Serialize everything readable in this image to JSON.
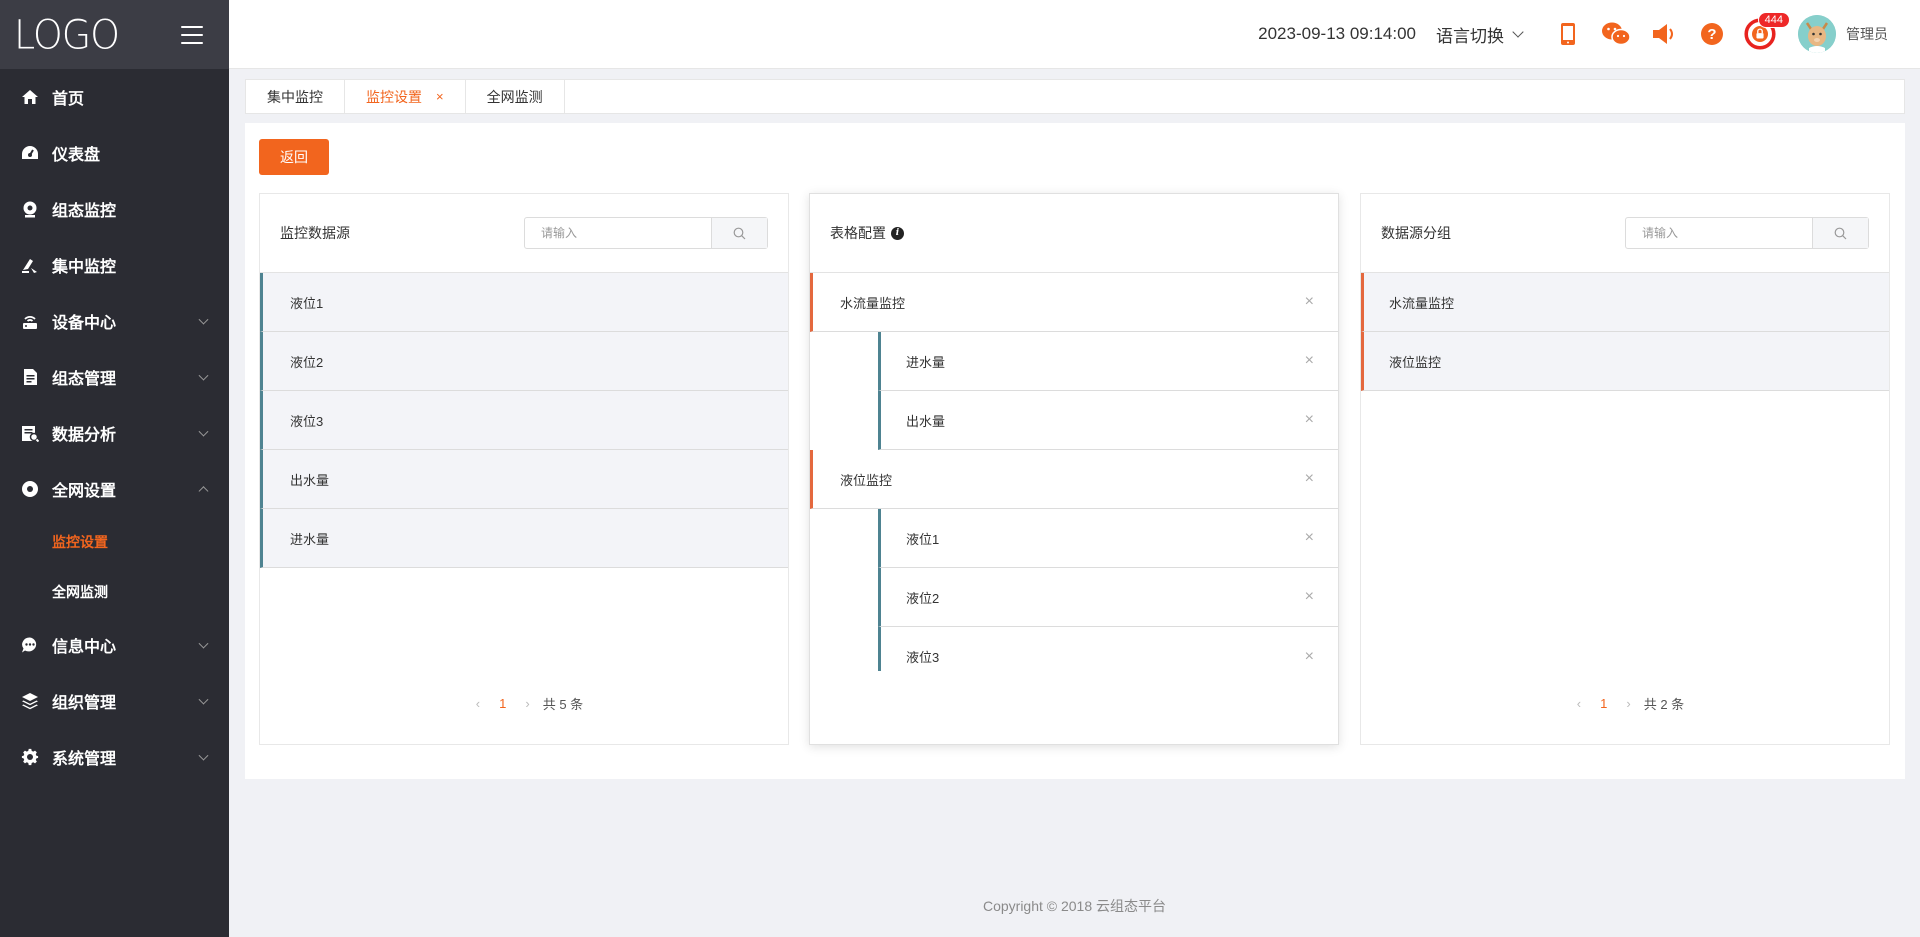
{
  "sidebar": {
    "logo": "LOGO",
    "items": [
      {
        "label": "首页",
        "icon": "home-icon"
      },
      {
        "label": "仪表盘",
        "icon": "dashboard-icon"
      },
      {
        "label": "组态监控",
        "icon": "monitor-icon"
      },
      {
        "label": "集中监控",
        "icon": "central-monitor-icon"
      },
      {
        "label": "设备中心",
        "icon": "router-icon"
      },
      {
        "label": "组态管理",
        "icon": "document-icon"
      },
      {
        "label": "数据分析",
        "icon": "analysis-icon"
      },
      {
        "label": "全网设置",
        "icon": "network-settings-icon"
      },
      {
        "label": "信息中心",
        "icon": "chat-icon"
      },
      {
        "label": "组织管理",
        "icon": "layers-icon"
      },
      {
        "label": "系统管理",
        "icon": "gear-icon"
      }
    ],
    "submenu": [
      "监控设置",
      "全网监测"
    ]
  },
  "header": {
    "datetime": "2023-09-13 09:14:00",
    "lang_label": "语言切换",
    "badge_count": "444",
    "user_name": "管理员",
    "accent_color": "#f2651e"
  },
  "tabs": [
    {
      "label": "集中监控"
    },
    {
      "label": "监控设置",
      "close": "×"
    },
    {
      "label": "全网监测"
    }
  ],
  "main": {
    "back_label": "返回",
    "panels": {
      "source": {
        "title": "监控数据源",
        "placeholder": "请输入",
        "items": [
          "液位1",
          "液位2",
          "液位3",
          "出水量",
          "进水量"
        ],
        "page": "1",
        "total": "共 5 条"
      },
      "config": {
        "title": "表格配置",
        "info": "i",
        "groups": [
          {
            "label": "水流量监控",
            "children": [
              "进水量",
              "出水量"
            ]
          },
          {
            "label": "液位监控",
            "children": [
              "液位1",
              "液位2",
              "液位3"
            ]
          }
        ]
      },
      "group": {
        "title": "数据源分组",
        "placeholder": "请输入",
        "items": [
          "水流量监控",
          "液位监控"
        ],
        "page": "1",
        "total": "共 2 条"
      }
    }
  },
  "pager_arrows": {
    "prev": "‹",
    "next": "›"
  },
  "close_glyph": "×",
  "footer": "Copyright © 2018 云组态平台"
}
